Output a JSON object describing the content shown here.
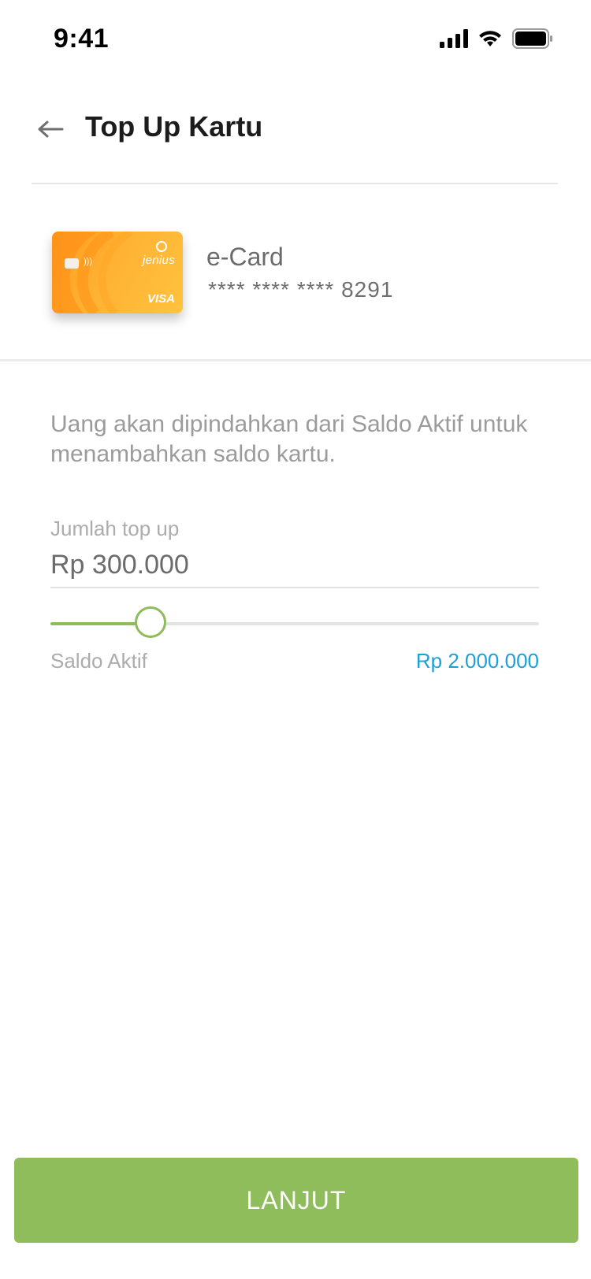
{
  "status_bar": {
    "time": "9:41",
    "icons": [
      "cellular-signal-icon",
      "wifi-icon",
      "battery-icon"
    ]
  },
  "header": {
    "title": "Top Up Kartu",
    "back_icon": "arrow-left-icon"
  },
  "card": {
    "name": "e-Card",
    "number": "**** **** **** 8291",
    "brand": "jenius",
    "network": "VISA"
  },
  "info": {
    "text": "Uang akan dipindahkan dari Saldo Aktif untuk menambahkan saldo kartu."
  },
  "amount": {
    "label": "Jumlah top up",
    "value": "Rp 300.000"
  },
  "slider": {
    "fraction": 0.205,
    "min_label": "Saldo Aktif",
    "max_label": "Rp 2.000.000"
  },
  "footer": {
    "button_label": "LANJUT"
  },
  "colors": {
    "accent_green": "#8fbd5c",
    "link_blue": "#1aa1d8",
    "card_orange": "#ffb233"
  }
}
